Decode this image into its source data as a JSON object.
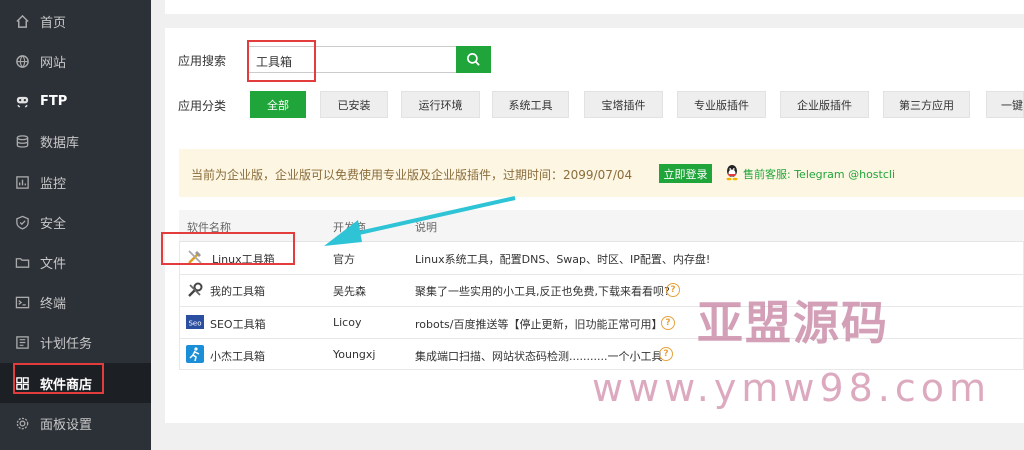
{
  "sidebar": {
    "items": [
      {
        "label": "首页",
        "icon": "home-icon"
      },
      {
        "label": "网站",
        "icon": "globe-icon"
      },
      {
        "label": "FTP",
        "icon": "ftp-icon"
      },
      {
        "label": "数据库",
        "icon": "database-icon"
      },
      {
        "label": "监控",
        "icon": "monitor-icon"
      },
      {
        "label": "安全",
        "icon": "shield-icon"
      },
      {
        "label": "文件",
        "icon": "folder-icon"
      },
      {
        "label": "终端",
        "icon": "terminal-icon"
      },
      {
        "label": "计划任务",
        "icon": "clock-icon"
      },
      {
        "label": "软件商店",
        "icon": "grid-icon",
        "active": true
      },
      {
        "label": "面板设置",
        "icon": "gear-icon"
      }
    ]
  },
  "search": {
    "label": "应用搜索",
    "value": "工具箱"
  },
  "categories": {
    "label": "应用分类",
    "items": [
      "全部",
      "已安装",
      "运行环境",
      "系统工具",
      "宝塔插件",
      "专业版插件",
      "企业版插件",
      "第三方应用",
      "一键"
    ]
  },
  "notice": {
    "text": "当前为企业版，企业版可以免费使用专业版及企业版插件，过期时间：2099/07/04",
    "login_label": "立即登录",
    "support": "售前客服: Telegram @hostcli"
  },
  "table": {
    "headers": [
      "软件名称",
      "开发商",
      "说明"
    ],
    "rows": [
      {
        "name": "Linux工具箱",
        "dev": "官方",
        "desc": "Linux系统工具，配置DNS、Swap、时区、IP配置、内存盘!",
        "icon": "tools-icon"
      },
      {
        "name": "我的工具箱",
        "dev": "吴先森",
        "desc": "聚集了一些实用的小工具,反正也免费,下载来看看呗?",
        "icon": "wrench-icon"
      },
      {
        "name": "SEO工具箱",
        "dev": "Licoy",
        "desc": "robots/百度推送等【停止更新，旧功能正常可用】",
        "icon": "seo-icon"
      },
      {
        "name": "小杰工具箱",
        "dev": "Youngxj",
        "desc": "集成端口扫描、网站状态码检测...........一个小工具",
        "icon": "runner-icon"
      }
    ]
  },
  "watermark": {
    "line1": "亚盟源码",
    "line2": "www.ymw98.com"
  },
  "colors": {
    "sidebar_bg": "#2c3037",
    "accent_green": "#20a53a",
    "annotation_red": "#e23c3c",
    "arrow_cyan": "#2ec4d6"
  }
}
